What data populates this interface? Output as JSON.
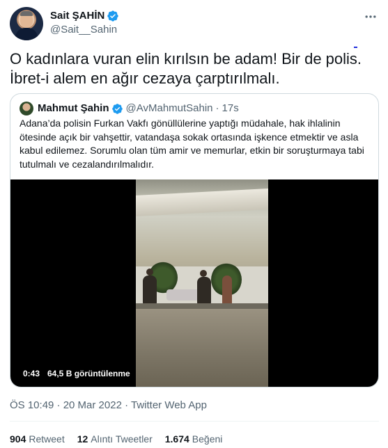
{
  "author": {
    "display_name": "Sait ŞAHİN",
    "handle": "@Sait__Sahin",
    "verified": true
  },
  "tweet": {
    "text_line1": "O kadınlara vuran elin kırılsın be adam! Bir de polis.",
    "text_line2": "İbret-i alem en ağır cezaya çarptırılmalı."
  },
  "quoted_tweet": {
    "display_name": "Mahmut Şahin",
    "handle": "@AvMahmutSahin",
    "separator": "·",
    "time": "17s",
    "verified": true,
    "text": "Adana’da polisin Furkan Vakfı gönüllülerine yaptığı müdahale, hak ihlalinin ötesinde açık bir vahşettir, vatandaşa sokak ortasında işkence etmektir ve asla kabul edilemez. Sorumlu olan tüm amir ve memurlar, etkin bir soruşturmaya tabi tutulmalı ve cezalandırılmalıdır.",
    "video": {
      "duration": "0:43",
      "views": "64,5 B görüntülenme"
    }
  },
  "meta": {
    "timestamp": "ÖS 10:49 · 20 Mar 2022 · Twitter Web App"
  },
  "stats": [
    {
      "count": "904",
      "label": "Retweet"
    },
    {
      "count": "12",
      "label": "Alıntı Tweetler"
    },
    {
      "count": "1.674",
      "label": "Beğeni"
    }
  ],
  "icons": {
    "more": "more-horizontal-icon",
    "verified": "verified-badge-icon"
  },
  "colors": {
    "verified_blue": "#1d9bf0",
    "secondary_text": "#536471",
    "primary_text": "#0f1419",
    "border": "#cfd9de"
  }
}
